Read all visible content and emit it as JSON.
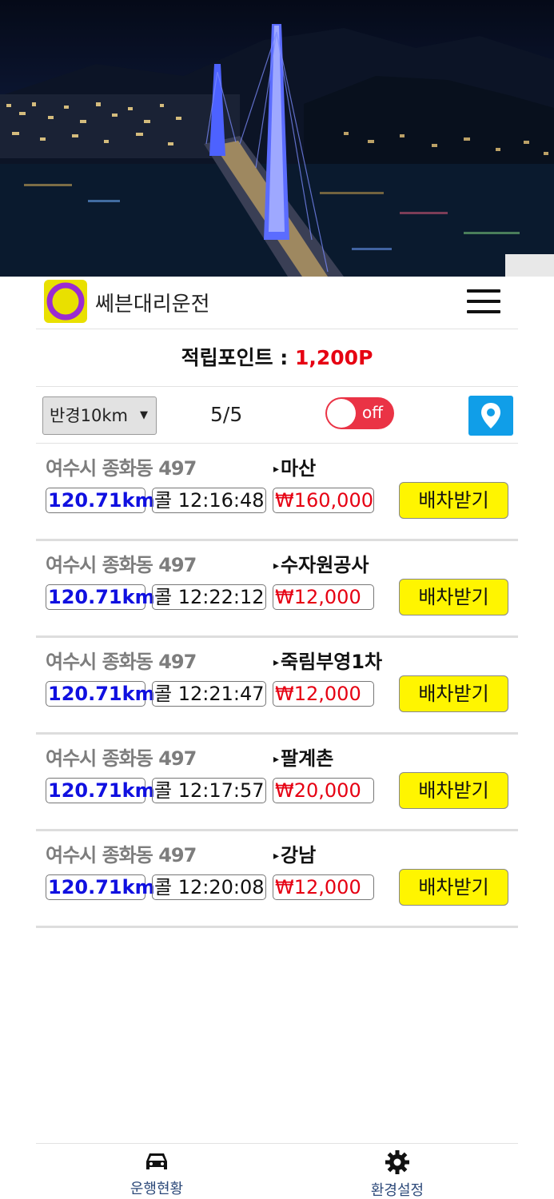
{
  "header": {
    "app_title": "쎄븐대리운전",
    "menu_icon": "hamburger-menu-icon",
    "logo_icon": "seven-logo-icon"
  },
  "points": {
    "label": "적립포인트 :",
    "value": "1,200P"
  },
  "filter": {
    "radius": "반경10km",
    "count": "5/5",
    "toggle_label": "off",
    "map_icon": "location-pin-icon"
  },
  "calls": [
    {
      "origin": "여수시 종화동 497",
      "destination": "마산",
      "distance": "120.71km",
      "time": "콜 12:16:48",
      "fare": "₩160,000",
      "button": "배차받기"
    },
    {
      "origin": "여수시 종화동 497",
      "destination": "수자원공사",
      "distance": "120.71km",
      "time": "콜 12:22:12",
      "fare": "₩12,000",
      "button": "배차받기"
    },
    {
      "origin": "여수시 종화동 497",
      "destination": "죽림부영1차",
      "distance": "120.71km",
      "time": "콜 12:21:47",
      "fare": "₩12,000",
      "button": "배차받기"
    },
    {
      "origin": "여수시 종화동 497",
      "destination": "팔계촌",
      "distance": "120.71km",
      "time": "콜 12:17:57",
      "fare": "₩20,000",
      "button": "배차받기"
    },
    {
      "origin": "여수시 종화동 497",
      "destination": "강남",
      "distance": "120.71km",
      "time": "콜 12:20:08",
      "fare": "₩12,000",
      "button": "배차받기"
    }
  ],
  "bottom_nav": {
    "drive_label": "운행현황",
    "drive_icon": "car-icon",
    "settings_label": "환경설정",
    "settings_icon": "gear-icon"
  },
  "colors": {
    "accent_red": "#e60012",
    "distance_blue": "#1010e0",
    "button_yellow": "#fff500",
    "toggle_red": "#ea3345",
    "map_button_blue": "#109ee8",
    "logo_yellow": "#e9e000"
  }
}
